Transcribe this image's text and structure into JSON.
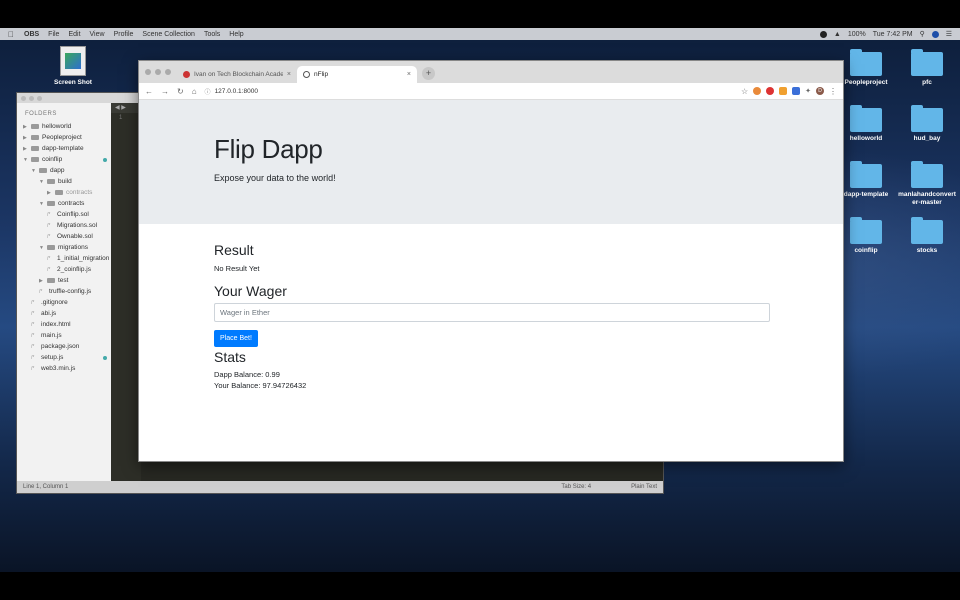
{
  "menubar": {
    "app_name": "OBS",
    "items": [
      "File",
      "Edit",
      "View",
      "Profile",
      "Scene Collection",
      "Tools",
      "Help"
    ],
    "battery": "100%",
    "clock": "Tue 7:42 PM"
  },
  "desktop": {
    "screenshot_label": "Screen Shot",
    "folders": [
      {
        "label": "Peopleproject"
      },
      {
        "label": "pfc"
      },
      {
        "label": "helloworld"
      },
      {
        "label": "hud_bay"
      },
      {
        "label": "dapp-template"
      },
      {
        "label": "manlahandconvert er-master"
      },
      {
        "label": "coinflip"
      },
      {
        "label": "stocks"
      }
    ]
  },
  "editor": {
    "sidebar_header": "FOLDERS",
    "tree": [
      {
        "label": "helloworld",
        "depth": 0,
        "kind": "folder",
        "open": false
      },
      {
        "label": "Peopleproject",
        "depth": 0,
        "kind": "folder",
        "open": false
      },
      {
        "label": "dapp-template",
        "depth": 0,
        "kind": "folder",
        "open": false
      },
      {
        "label": "coinflip",
        "depth": 0,
        "kind": "folder",
        "open": true,
        "modified": true
      },
      {
        "label": "dapp",
        "depth": 1,
        "kind": "folder",
        "open": true
      },
      {
        "label": "build",
        "depth": 2,
        "kind": "folder",
        "open": true
      },
      {
        "label": "contracts",
        "depth": 3,
        "kind": "folder",
        "open": false,
        "dim": true
      },
      {
        "label": "contracts",
        "depth": 2,
        "kind": "folder",
        "open": true
      },
      {
        "label": "Coinflip.sol",
        "depth": 3,
        "kind": "file"
      },
      {
        "label": "Migrations.sol",
        "depth": 3,
        "kind": "file"
      },
      {
        "label": "Ownable.sol",
        "depth": 3,
        "kind": "file"
      },
      {
        "label": "migrations",
        "depth": 2,
        "kind": "folder",
        "open": true
      },
      {
        "label": "1_initial_migration",
        "depth": 3,
        "kind": "file"
      },
      {
        "label": "2_coinflip.js",
        "depth": 3,
        "kind": "file"
      },
      {
        "label": "test",
        "depth": 2,
        "kind": "folder",
        "open": false
      },
      {
        "label": "truffle-config.js",
        "depth": 2,
        "kind": "file"
      },
      {
        "label": ".gitignore",
        "depth": 1,
        "kind": "file"
      },
      {
        "label": "abi.js",
        "depth": 1,
        "kind": "file"
      },
      {
        "label": "index.html",
        "depth": 1,
        "kind": "file"
      },
      {
        "label": "main.js",
        "depth": 1,
        "kind": "file"
      },
      {
        "label": "package.json",
        "depth": 1,
        "kind": "file"
      },
      {
        "label": "setup.js",
        "depth": 1,
        "kind": "file",
        "modified": true
      },
      {
        "label": "web3.min.js",
        "depth": 1,
        "kind": "file"
      }
    ],
    "line_number": "1",
    "status_left": "Line 1, Column 1",
    "status_tab": "Tab Size: 4",
    "status_syntax": "Plain Text"
  },
  "browser": {
    "tabs": [
      {
        "label": "Ivan on Tech Blockchain Acade",
        "active": false
      },
      {
        "label": "nFlip",
        "active": true
      }
    ],
    "url": "127.0.0.1:8000",
    "avatar_letter": "D"
  },
  "page": {
    "title": "Flip Dapp",
    "subtitle": "Expose your data to the world!",
    "result_heading": "Result",
    "result_text": "No Result Yet",
    "wager_heading": "Your Wager",
    "wager_placeholder": "Wager in Ether",
    "bet_button": "Place Bet!",
    "stats_heading": "Stats",
    "dapp_balance": "Dapp Balance: 0.99",
    "your_balance": "Your Balance: 97.94726432"
  },
  "colors": {
    "primary": "#007bff",
    "jumbotron": "#e9ecef",
    "folder": "#62b6e8"
  }
}
